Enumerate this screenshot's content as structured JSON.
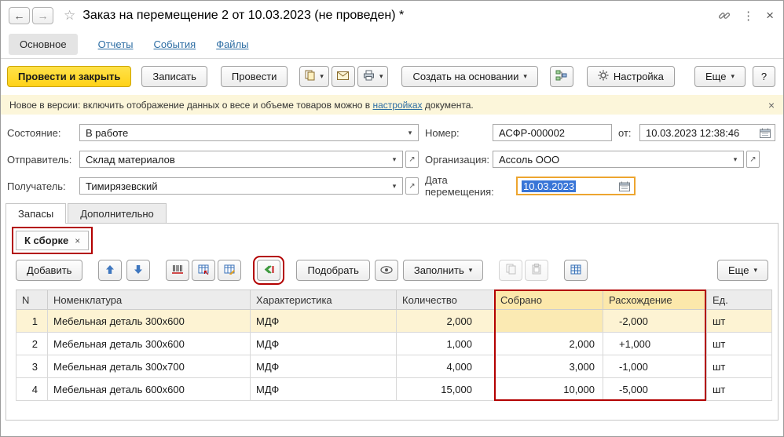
{
  "window": {
    "title": "Заказ на перемещение 2 от 10.03.2023 (не проведен) *",
    "help": "?"
  },
  "icons": {
    "back": "←",
    "forward": "→",
    "star": "☆",
    "kebab": "⋮",
    "close": "×",
    "caret": "▾",
    "open": "↗"
  },
  "nav": {
    "main": "Основное",
    "reports": "Отчеты",
    "events": "События",
    "files": "Файлы"
  },
  "toolbar": {
    "post_close": "Провести и закрыть",
    "save": "Записать",
    "post": "Провести",
    "create_from": "Создать на основании",
    "settings": "Настройка",
    "more": "Еще"
  },
  "banner": {
    "prefix": "Новое в версии: включить отображение данных о весе и объеме товаров можно в ",
    "link": "настройках",
    "suffix": " документа."
  },
  "form": {
    "state_label": "Состояние:",
    "state_value": "В работе",
    "number_label": "Номер:",
    "number_value": "АСФР-000002",
    "date_label": "от:",
    "date_value": "10.03.2023 12:38:46",
    "sender_label": "Отправитель:",
    "sender_value": "Склад материалов",
    "org_label": "Организация:",
    "org_value": "Ассоль ООО",
    "receiver_label": "Получатель:",
    "receiver_value": "Тимирязевский",
    "move_date_label": "Дата перемещения:",
    "move_date_value": "10.03.2023"
  },
  "tabs": {
    "inventory": "Запасы",
    "additional": "Дополнительно"
  },
  "filter_chip": {
    "label": "К сборке"
  },
  "grid_toolbar": {
    "add": "Добавить",
    "pick": "Подобрать",
    "fill": "Заполнить",
    "more": "Еще"
  },
  "table": {
    "headers": [
      "N",
      "Номенклатура",
      "Характеристика",
      "Количество",
      "Собрано",
      "Расхождение",
      "Ед."
    ],
    "rows": [
      {
        "n": "1",
        "name": "Мебельная деталь 300х600",
        "char": "МДФ",
        "qty": "2,000",
        "collected": "",
        "diff": "-2,000",
        "unit": "шт"
      },
      {
        "n": "2",
        "name": "Мебельная деталь 300х600",
        "char": "МДФ",
        "qty": "1,000",
        "collected": "2,000",
        "diff": "+1,000",
        "unit": "шт"
      },
      {
        "n": "3",
        "name": "Мебельная деталь 300х700",
        "char": "МДФ",
        "qty": "4,000",
        "collected": "3,000",
        "diff": "-1,000",
        "unit": "шт"
      },
      {
        "n": "4",
        "name": "Мебельная деталь 600х600",
        "char": "МДФ",
        "qty": "15,000",
        "collected": "10,000",
        "diff": "-5,000",
        "unit": "шт"
      }
    ]
  },
  "colors": {
    "accent_yellow": "#ffd92e",
    "annotation_red": "#b30000",
    "link_blue": "#2d6da3",
    "header_highlight": "#fce8ab",
    "selected_row": "#fdf3d3"
  }
}
